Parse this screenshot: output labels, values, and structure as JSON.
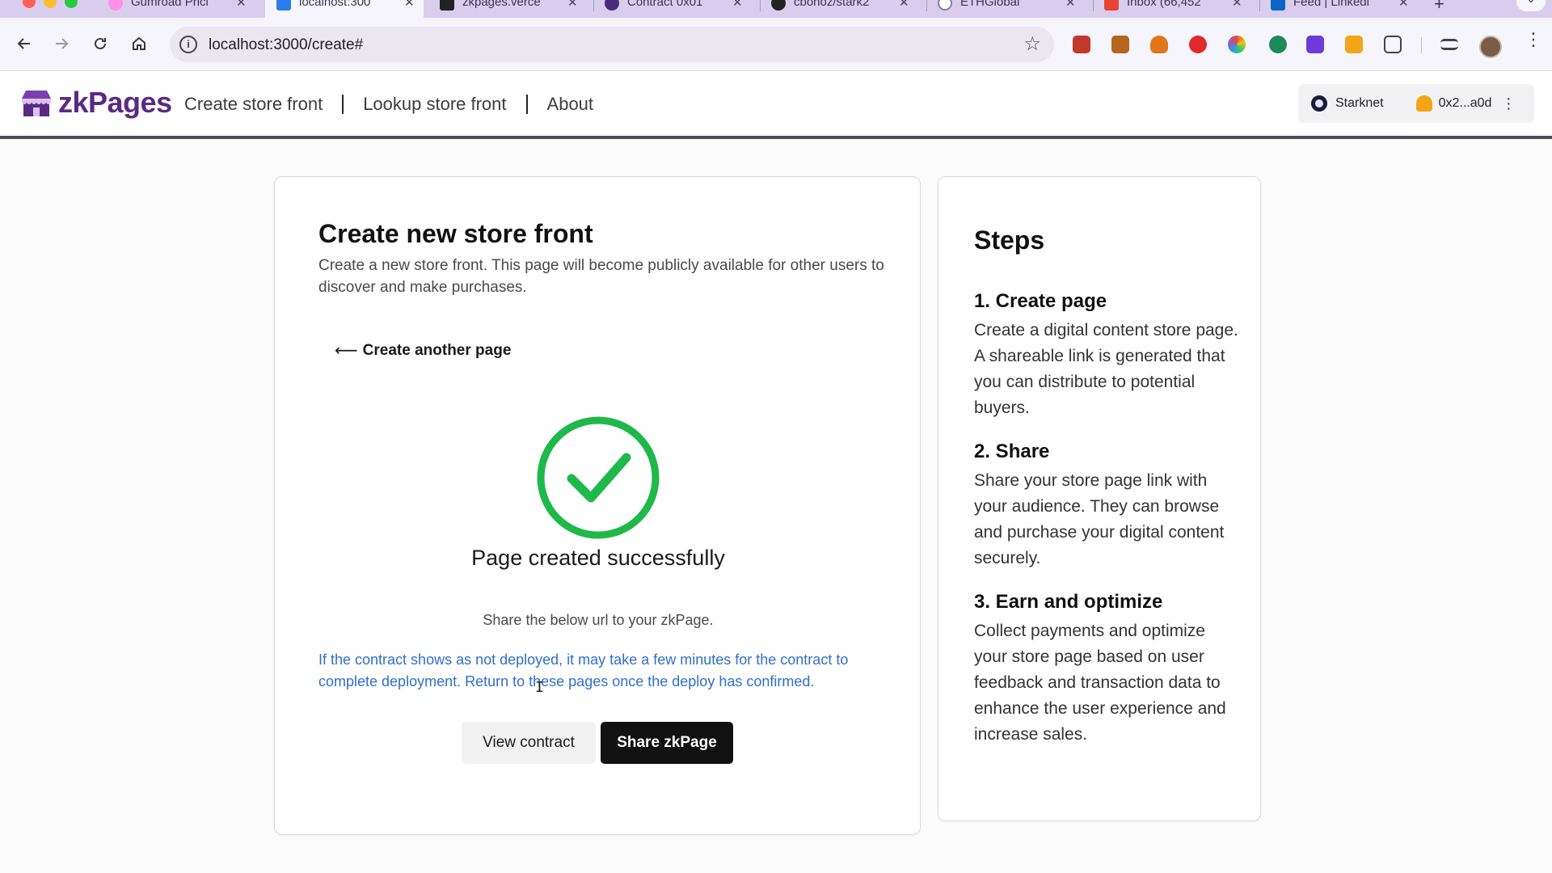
{
  "browser": {
    "tabs": [
      {
        "title": "Gumroad Prici",
        "active": false
      },
      {
        "title": "localhost:300",
        "active": true
      },
      {
        "title": "zkpages.verce",
        "active": false
      },
      {
        "title": "Contract 0x01",
        "active": false
      },
      {
        "title": "cbonoz/stark2",
        "active": false
      },
      {
        "title": "ETHGlobal",
        "active": false
      },
      {
        "title": "Inbox (66,452",
        "active": false
      },
      {
        "title": "Feed | Linkedi",
        "active": false
      }
    ],
    "close_glyph": "✕",
    "new_tab_glyph": "+",
    "url": "localhost:3000/create#",
    "colors": {
      "tabstrip": "#d9cdee",
      "toolbar": "#f7f5fc"
    }
  },
  "header": {
    "brand": "zkPages",
    "nav": [
      "Create store front",
      "Lookup store front",
      "About"
    ],
    "network": "Starknet",
    "account": "0x2...a0d",
    "colors": {
      "brand": "#5a2a82"
    }
  },
  "main": {
    "title": "Create new store front",
    "description": "Create a new store front. This page will become publicly available for other users to discover and make purchases.",
    "back_link": "Create another page",
    "success_message": "Page created successfully",
    "share_hint": "Share the below url to your zkPage.",
    "deploy_note": "If the contract shows as not deployed, it may take a few minutes for the contract to complete deployment. Return to these pages once the deploy has confirmed.",
    "view_contract_label": "View contract",
    "share_label": "Share zkPage",
    "colors": {
      "success": "#1fb84a",
      "note": "#2f6fd0"
    }
  },
  "steps": {
    "title": "Steps",
    "items": [
      {
        "heading": "1. Create page",
        "body": "Create a digital content store page. A shareable link is generated that you can distribute to potential buyers."
      },
      {
        "heading": "2. Share",
        "body": "Share your store page link with your audience. They can browse and purchase your digital content securely."
      },
      {
        "heading": "3. Earn and optimize",
        "body": "Collect payments and optimize your store page based on user feedback and transaction data to enhance the user experience and increase sales."
      }
    ]
  }
}
